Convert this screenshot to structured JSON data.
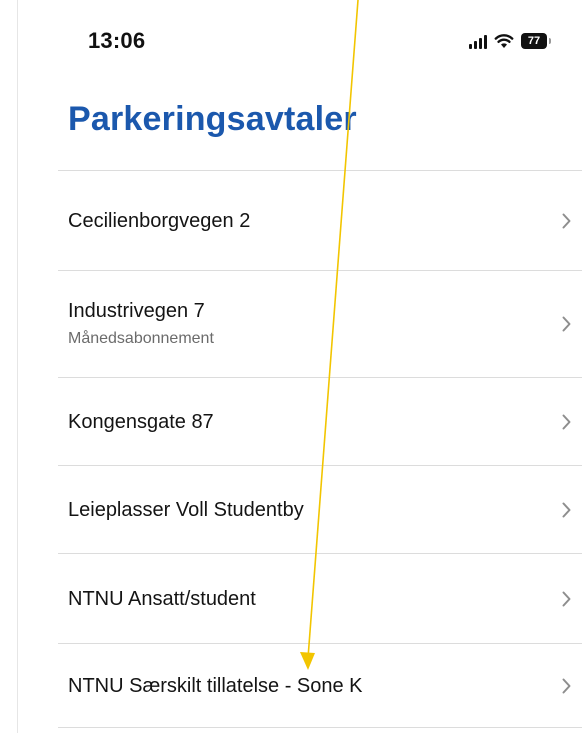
{
  "status_bar": {
    "time": "13:06",
    "signal_icon": "cellular-signal-icon",
    "wifi_icon": "wifi-icon",
    "battery_level": "77"
  },
  "page": {
    "title": "Parkeringsavtaler"
  },
  "agreements": [
    {
      "title": "Cecilienborgvegen 2",
      "subtitle": ""
    },
    {
      "title": "Industrivegen 7",
      "subtitle": "Månedsabonnement"
    },
    {
      "title": "Kongensgate 87",
      "subtitle": ""
    },
    {
      "title": "Leieplasser Voll Studentby",
      "subtitle": ""
    },
    {
      "title": "NTNU Ansatt/student",
      "subtitle": ""
    },
    {
      "title": "NTNU Særskilt tillatelse - Sone K",
      "subtitle": ""
    }
  ],
  "colors": {
    "title_blue": "#1b58ad",
    "annotation_arrow": "#f2c500",
    "chevron": "#8e8e8e"
  }
}
